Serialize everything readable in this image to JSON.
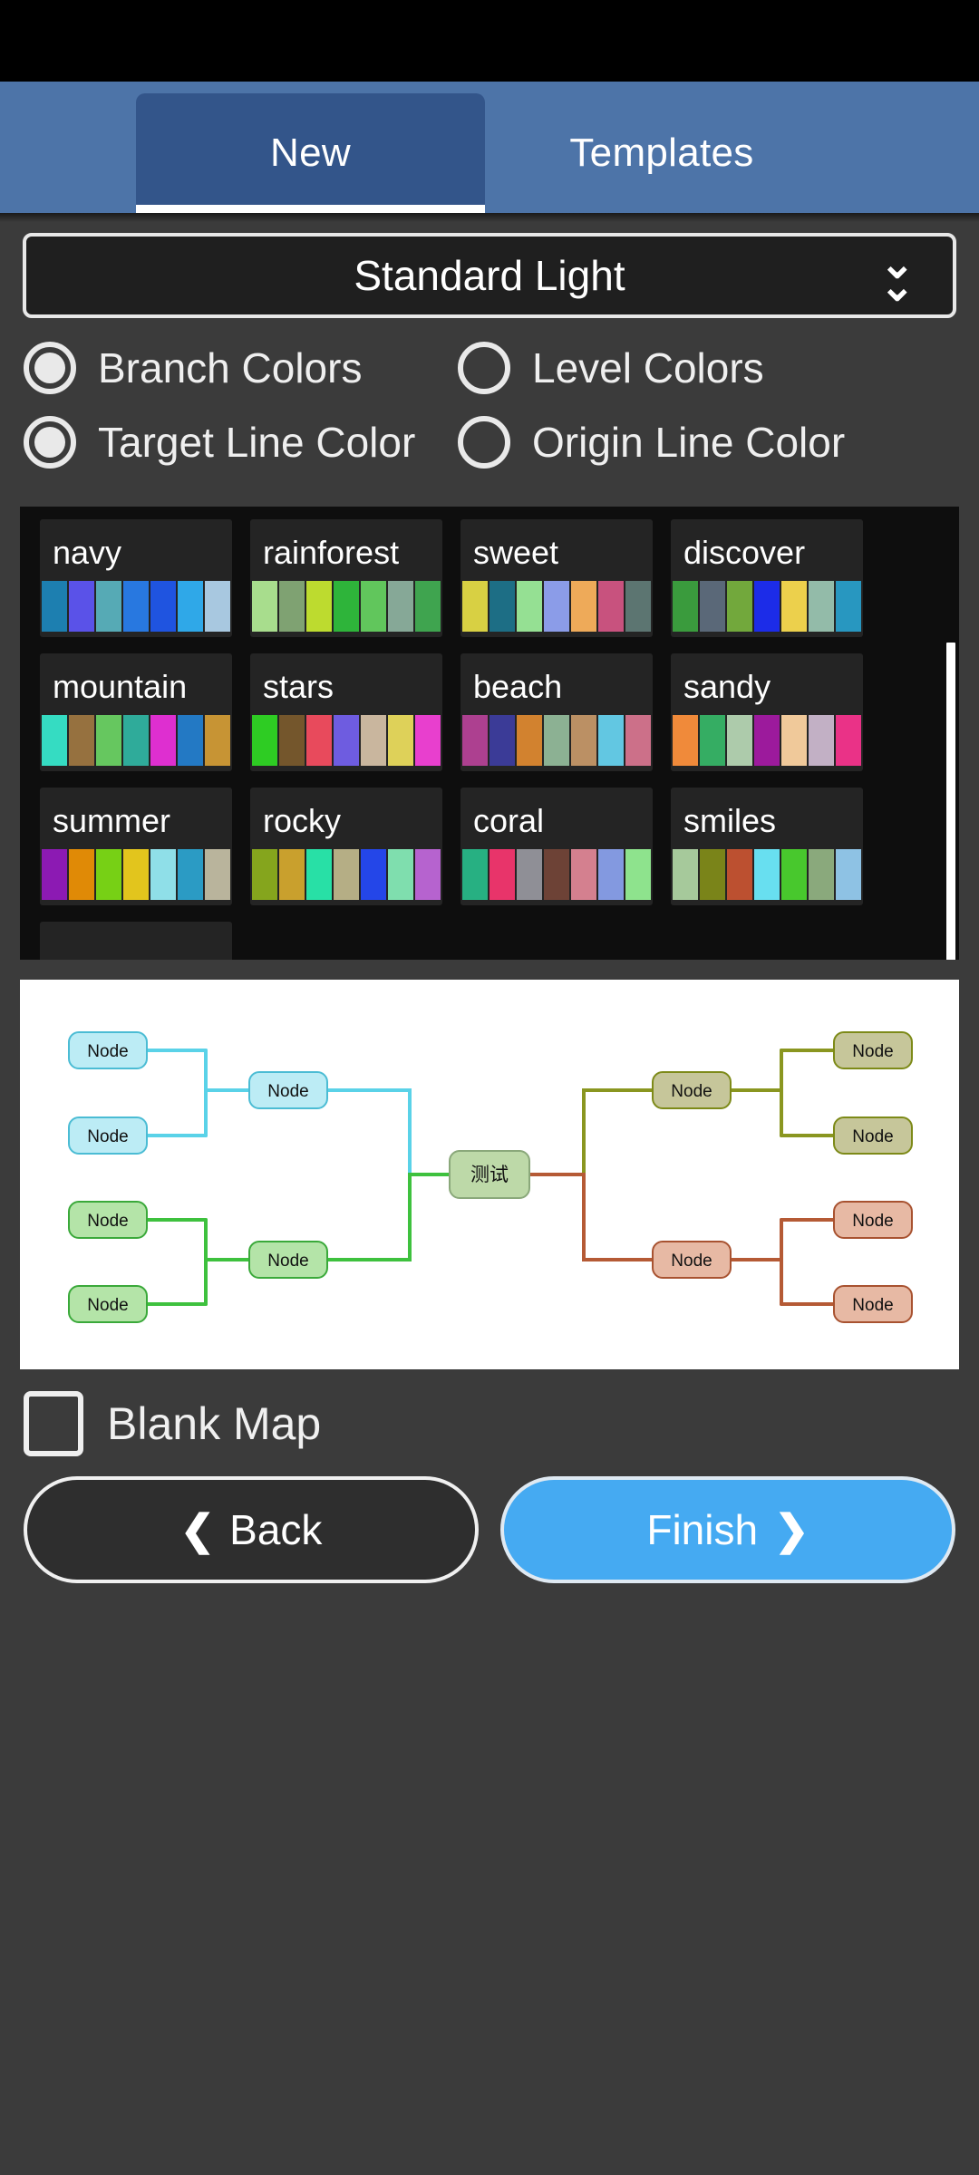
{
  "tabs": [
    {
      "label": "New",
      "active": true
    },
    {
      "label": "Templates",
      "active": false
    }
  ],
  "dropdown": {
    "selected": "Standard Light",
    "icon": "chevron-double-down-icon"
  },
  "radio_groups": [
    {
      "name": "color-mode",
      "options": [
        {
          "label": "Branch Colors",
          "selected": true
        },
        {
          "label": "Level Colors",
          "selected": false
        }
      ]
    },
    {
      "name": "line-color-mode",
      "options": [
        {
          "label": "Target Line Color",
          "selected": true
        },
        {
          "label": "Origin Line Color",
          "selected": false
        }
      ]
    }
  ],
  "palettes": [
    {
      "name": "navy",
      "colors": [
        "#1d7fb0",
        "#5a52e8",
        "#56aab5",
        "#2878e0",
        "#1f54e0",
        "#2fa8e8",
        "#a8c8e0"
      ]
    },
    {
      "name": "rainforest",
      "colors": [
        "#a8dd8d",
        "#7fa272",
        "#bddb2f",
        "#2eb43a",
        "#61c65c",
        "#86a897",
        "#3fa44f"
      ]
    },
    {
      "name": "sweet",
      "colors": [
        "#d8d043",
        "#1d6e85",
        "#95e093",
        "#8b9ce8",
        "#eeaa59",
        "#c8527e",
        "#5c7571"
      ]
    },
    {
      "name": "discover",
      "colors": [
        "#3a9b3d",
        "#5a6878",
        "#72a83c",
        "#1c2ce8",
        "#ecd04c",
        "#93bba9",
        "#2897c0"
      ]
    },
    {
      "name": "mountain",
      "colors": [
        "#35dcc2",
        "#96713f",
        "#66c75f",
        "#2fab9a",
        "#de2fd0",
        "#2379c4",
        "#c79434"
      ]
    },
    {
      "name": "stars",
      "colors": [
        "#2ecc23",
        "#74562c",
        "#e84a5c",
        "#6e5ce0",
        "#c9b69e",
        "#ded159",
        "#e83fce"
      ]
    },
    {
      "name": "beach",
      "colors": [
        "#ad4090",
        "#3b3b97",
        "#d2822f",
        "#8cb193",
        "#bb9064",
        "#62c7e2",
        "#cc7089"
      ]
    },
    {
      "name": "sandy",
      "colors": [
        "#f08a3a",
        "#35ad63",
        "#adcbab",
        "#9c1a9c",
        "#f0c99a",
        "#c2b0c5",
        "#ea3287"
      ]
    },
    {
      "name": "summer",
      "colors": [
        "#8c1ab3",
        "#e08a06",
        "#77d015",
        "#e2c51d",
        "#8fdfe8",
        "#2b9bc4",
        "#b9b49c"
      ]
    },
    {
      "name": "rocky",
      "colors": [
        "#85a51d",
        "#c9a02d",
        "#28e0a6",
        "#b5ae85",
        "#2446e8",
        "#7fdeae",
        "#b663cf"
      ]
    },
    {
      "name": "coral",
      "colors": [
        "#27b082",
        "#e8346a",
        "#8f8f96",
        "#6d4236",
        "#d4808f",
        "#8399e0",
        "#8ee38d"
      ]
    },
    {
      "name": "smiles",
      "colors": [
        "#a6c99b",
        "#7a8419",
        "#bc5030",
        "#68dff0",
        "#48c82d",
        "#8aa97c",
        "#8ec2e4"
      ]
    }
  ],
  "preview": {
    "root_label": "测试",
    "node_label": "Node",
    "branches": [
      {
        "line_color": "#5ad2e8",
        "node_fill": "#bcecf5",
        "node_stroke": "#4bbcd4"
      },
      {
        "line_color": "#8a9620",
        "node_fill": "#c6c69a",
        "node_stroke": "#7d8a18"
      },
      {
        "line_color": "#3ec13e",
        "node_fill": "#b4e4a8",
        "node_stroke": "#3aa93a"
      },
      {
        "line_color": "#b55a35",
        "node_fill": "#e7b9a4",
        "node_stroke": "#a85230"
      }
    ],
    "root_fill": "#bdd9a8",
    "root_stroke": "#8aa87a"
  },
  "bottom": {
    "blank_map_label": "Blank Map",
    "blank_map_checked": false,
    "back_label": "Back",
    "finish_label": "Finish",
    "back_icon": "chevron-left-icon",
    "finish_icon": "chevron-right-icon"
  },
  "colors": {
    "accent": "#45aaf2",
    "tabbar": "#4d74a8",
    "tab_active": "#33558a",
    "page_bg": "#3b3b3b",
    "list_bg": "#0e0e0e",
    "card_bg": "#242424"
  }
}
